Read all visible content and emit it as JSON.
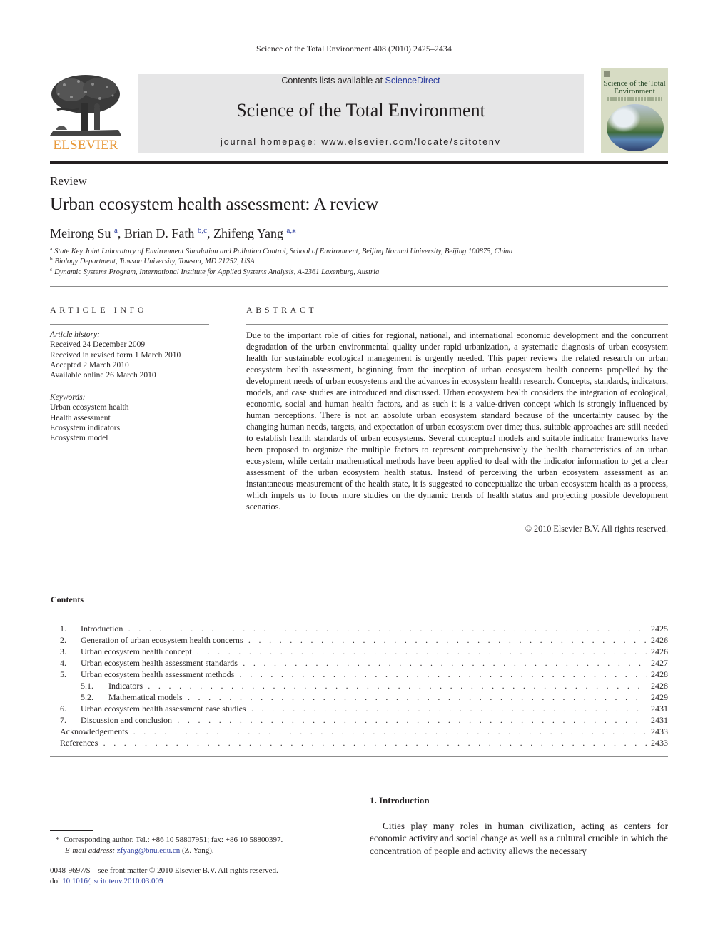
{
  "running_head": "Science of the Total Environment 408 (2010) 2425–2434",
  "header": {
    "publisher_word": "ELSEVIER",
    "contents_prefix": "Contents lists available at ",
    "contents_link": "ScienceDirect",
    "journal_title": "Science of the Total Environment",
    "homepage": "journal homepage: www.elsevier.com/locate/scitotenv",
    "cover_title": "Science of the Total Environment"
  },
  "article": {
    "type": "Review",
    "title": "Urban ecosystem health assessment: A review",
    "authors": [
      {
        "name": "Meirong Su",
        "sup": "a"
      },
      {
        "name": "Brian D. Fath",
        "sup": "b,c"
      },
      {
        "name": "Zhifeng Yang",
        "sup": "a,⁎"
      }
    ],
    "affiliations": [
      {
        "mark": "a",
        "text": "State Key Joint Laboratory of Environment Simulation and Pollution Control, School of Environment, Beijing Normal University, Beijing 100875, China"
      },
      {
        "mark": "b",
        "text": "Biology Department, Towson University, Towson, MD 21252, USA"
      },
      {
        "mark": "c",
        "text": "Dynamic Systems Program, International Institute for Applied Systems Analysis, A-2361 Laxenburg, Austria"
      }
    ]
  },
  "article_info": {
    "heading": "ARTICLE INFO",
    "history_label": "Article history:",
    "history": [
      "Received 24 December 2009",
      "Received in revised form 1 March 2010",
      "Accepted 2 March 2010",
      "Available online 26 March 2010"
    ],
    "keywords_label": "Keywords:",
    "keywords": [
      "Urban ecosystem health",
      "Health assessment",
      "Ecosystem indicators",
      "Ecosystem model"
    ]
  },
  "abstract": {
    "heading": "ABSTRACT",
    "text": "Due to the important role of cities for regional, national, and international economic development and the concurrent degradation of the urban environmental quality under rapid urbanization, a systematic diagnosis of urban ecosystem health for sustainable ecological management is urgently needed. This paper reviews the related research on urban ecosystem health assessment, beginning from the inception of urban ecosystem health concerns propelled by the development needs of urban ecosystems and the advances in ecosystem health research. Concepts, standards, indicators, models, and case studies are introduced and discussed. Urban ecosystem health considers the integration of ecological, economic, social and human health factors, and as such it is a value-driven concept which is strongly influenced by human perceptions. There is not an absolute urban ecosystem standard because of the uncertainty caused by the changing human needs, targets, and expectation of urban ecosystem over time; thus, suitable approaches are still needed to establish health standards of urban ecosystems. Several conceptual models and suitable indicator frameworks have been proposed to organize the multiple factors to represent comprehensively the health characteristics of an urban ecosystem, while certain mathematical methods have been applied to deal with the indicator information to get a clear assessment of the urban ecosystem health status. Instead of perceiving the urban ecosystem assessment as an instantaneous measurement of the health state, it is suggested to conceptualize the urban ecosystem health as a process, which impels us to focus more studies on the dynamic trends of health status and projecting possible development scenarios.",
    "copyright": "© 2010 Elsevier B.V. All rights reserved."
  },
  "contents": {
    "heading": "Contents",
    "items": [
      {
        "num": "1.",
        "label": "Introduction",
        "page": "2425",
        "level": 1
      },
      {
        "num": "2.",
        "label": "Generation of urban ecosystem health concerns",
        "page": "2426",
        "level": 1
      },
      {
        "num": "3.",
        "label": "Urban ecosystem health concept",
        "page": "2426",
        "level": 1
      },
      {
        "num": "4.",
        "label": "Urban ecosystem health assessment standards",
        "page": "2427",
        "level": 1
      },
      {
        "num": "5.",
        "label": "Urban ecosystem health assessment methods",
        "page": "2428",
        "level": 1
      },
      {
        "num": "5.1.",
        "label": "Indicators",
        "page": "2428",
        "level": 2
      },
      {
        "num": "5.2.",
        "label": "Mathematical models",
        "page": "2429",
        "level": 2
      },
      {
        "num": "6.",
        "label": "Urban ecosystem health assessment case studies",
        "page": "2431",
        "level": 1
      },
      {
        "num": "7.",
        "label": "Discussion and conclusion",
        "page": "2431",
        "level": 1
      },
      {
        "num": "",
        "label": "Acknowledgements",
        "page": "2433",
        "level": 0
      },
      {
        "num": "",
        "label": "References",
        "page": "2433",
        "level": 0
      }
    ]
  },
  "introduction": {
    "heading": "1. Introduction",
    "text": "Cities play many roles in human civilization, acting as centers for economic activity and social change as well as a cultural crucible in which the concentration of people and activity allows the necessary"
  },
  "footnote": {
    "mark": "*",
    "corresponding": "Corresponding author. Tel.: +86 10 58807951; fax: +86 10 58800397.",
    "email_label": "E-mail address:",
    "email": "zfyang@bnu.edu.cn",
    "email_suffix": "(Z. Yang)."
  },
  "front_matter": {
    "issn_line": "0048-9697/$ – see front matter © 2010 Elsevier B.V. All rights reserved.",
    "doi_label": "doi:",
    "doi": "10.1016/j.scitotenv.2010.03.009"
  },
  "colors": {
    "link": "#2c3d9e",
    "elsevier_orange": "#e8993a",
    "banner_bg": "#e6e6e7"
  }
}
